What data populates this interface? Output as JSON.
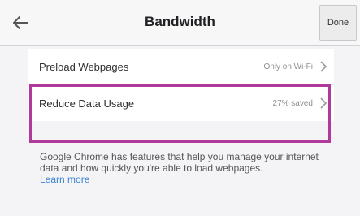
{
  "header": {
    "title": "Bandwidth",
    "done_label": "Done"
  },
  "settings": {
    "items": [
      {
        "label": "Preload Webpages",
        "value": "Only on Wi-Fi"
      },
      {
        "label": "Reduce Data Usage",
        "value": "27% saved"
      }
    ]
  },
  "description": {
    "text": "Google Chrome has features that help you manage your internet data and how quickly you're able to load webpages.",
    "link_label": "Learn more"
  },
  "colors": {
    "highlight": "#b03a9a",
    "link": "#3b84d3"
  }
}
